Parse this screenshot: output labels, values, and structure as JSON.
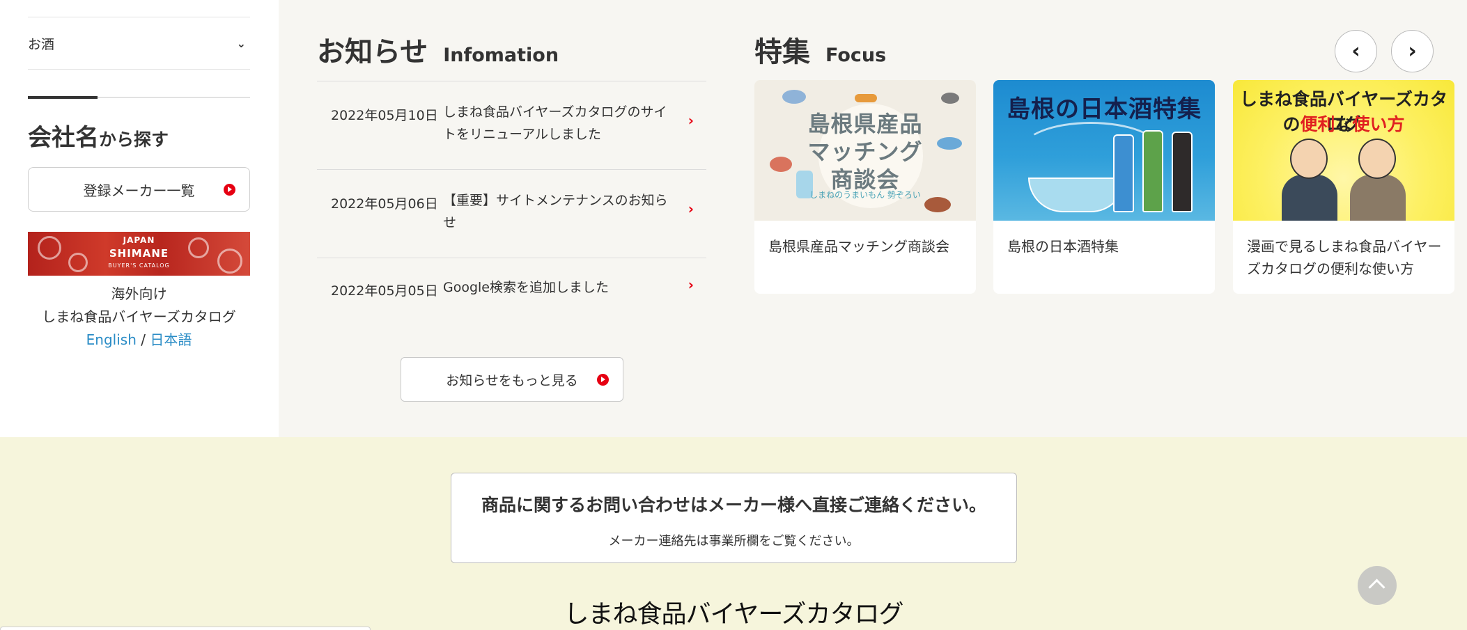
{
  "sidebar": {
    "category_label": "お酒",
    "company_heading_big": "会社名",
    "company_heading_small": "から探す",
    "makers_button": "登録メーカー一覧",
    "banner": {
      "line1": "JAPAN",
      "line2": "SHIMANE",
      "line3": "BUYER'S CATALOG"
    },
    "overseas_line1": "海外向け",
    "overseas_line2": "しまね食品バイヤーズカタログ",
    "lang_english": "English",
    "lang_sep": "/",
    "lang_japanese": "日本語"
  },
  "info": {
    "title_jp": "お知らせ",
    "title_en": "Infomation",
    "items": [
      {
        "date": "2022年05月10日",
        "title": "しまね食品バイヤーズカタログのサイトをリニューアルしました"
      },
      {
        "date": "2022年05月06日",
        "title": "【重要】サイトメンテナンスのお知らせ"
      },
      {
        "date": "2022年05月05日",
        "title": "Google検索を追加しました"
      }
    ],
    "more_button": "お知らせをもっと見る"
  },
  "focus": {
    "title_jp": "特集",
    "title_en": "Focus",
    "prev_icon": "‹",
    "next_icon": "›",
    "cards": [
      {
        "caption": "島根県産品マッチング商談会",
        "thumb_lines": [
          "島根県産品",
          "マッチング",
          "商談会"
        ],
        "thumb_sub": "しまねのうまいもん 勢ぞろい"
      },
      {
        "caption": "島根の日本酒特集",
        "thumb_title": "島根の日本酒特集"
      },
      {
        "caption": "漫画で見るしまね食品バイヤーズカタログの便利な使い方",
        "thumb_title1": "しまね食品バイヤーズカタログ",
        "thumb_title2_a": "の",
        "thumb_title2_b": "便利",
        "thumb_title2_c": "な",
        "thumb_title2_d": "使い方"
      }
    ]
  },
  "bottom": {
    "contact_main": "商品に関するお問い合わせはメーカー様へ直接ご連絡ください。",
    "contact_sub": "メーカー連絡先は事業所欄をご覧ください。",
    "logo_text": "しまね食品バイヤーズカタログ"
  },
  "colors": {
    "accent_red": "#e60012",
    "link_blue": "#2a8cc6",
    "footer_bg": "#f6f5dc"
  },
  "icons": {
    "chevron": "chevron-down-icon",
    "arrow": "chevron-right-icon",
    "play": "red-play-icon",
    "back_to_top": "arrow-up-icon"
  }
}
